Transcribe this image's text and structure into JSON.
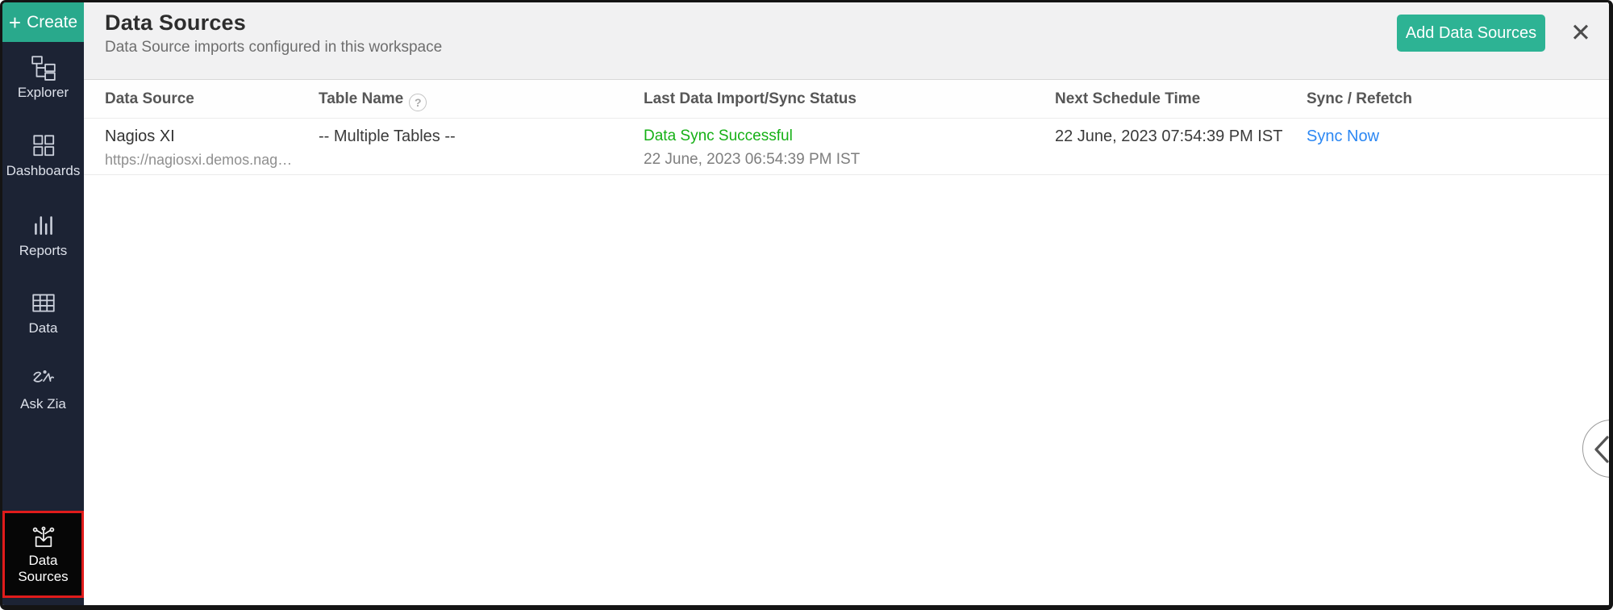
{
  "sidebar": {
    "create": {
      "label": "Create",
      "icon": "plus-icon"
    },
    "items": [
      {
        "label": "Explorer",
        "icon": "explorer-tree-icon"
      },
      {
        "label": "Dashboards",
        "icon": "dashboards-grid-icon"
      },
      {
        "label": "Reports",
        "icon": "reports-bars-icon"
      },
      {
        "label": "Data",
        "icon": "data-table-icon"
      },
      {
        "label": "Ask Zia",
        "icon": "zia-signature-icon"
      },
      {
        "label": "Data Sources",
        "icon": "data-sources-import-icon",
        "active": true
      }
    ]
  },
  "header": {
    "title": "Data Sources",
    "subtitle": "Data Source imports configured in this workspace",
    "add_button_label": "Add Data Sources",
    "close_icon": "close-icon",
    "close_glyph": "✕"
  },
  "table": {
    "columns": [
      "Data Source",
      "Table Name",
      "Last Data Import/Sync Status",
      "Next Schedule Time",
      "Sync / Refetch"
    ],
    "help_icon": "question-circle-icon",
    "help_glyph": "?",
    "rows": [
      {
        "name": "Nagios XI",
        "url": "https://nagiosxi.demos.nag…",
        "table_name": "-- Multiple Tables --",
        "sync_status": "Data Sync Successful",
        "last_sync_time": "22 June, 2023 06:54:39 PM IST",
        "next_schedule_time": "22 June, 2023 07:54:39 PM IST",
        "action": "Sync Now"
      }
    ]
  },
  "collapse_button": {
    "icon": "chevron-left-icon"
  },
  "colors": {
    "sidebar_bg": "#1c2334",
    "create_green": "#29a98c",
    "add_button_green": "#2db394",
    "active_item_border_red": "#e01b1b",
    "status_success_green": "#15b015",
    "link_blue": "#2b87f3",
    "header_bg": "#f1f1f2"
  }
}
